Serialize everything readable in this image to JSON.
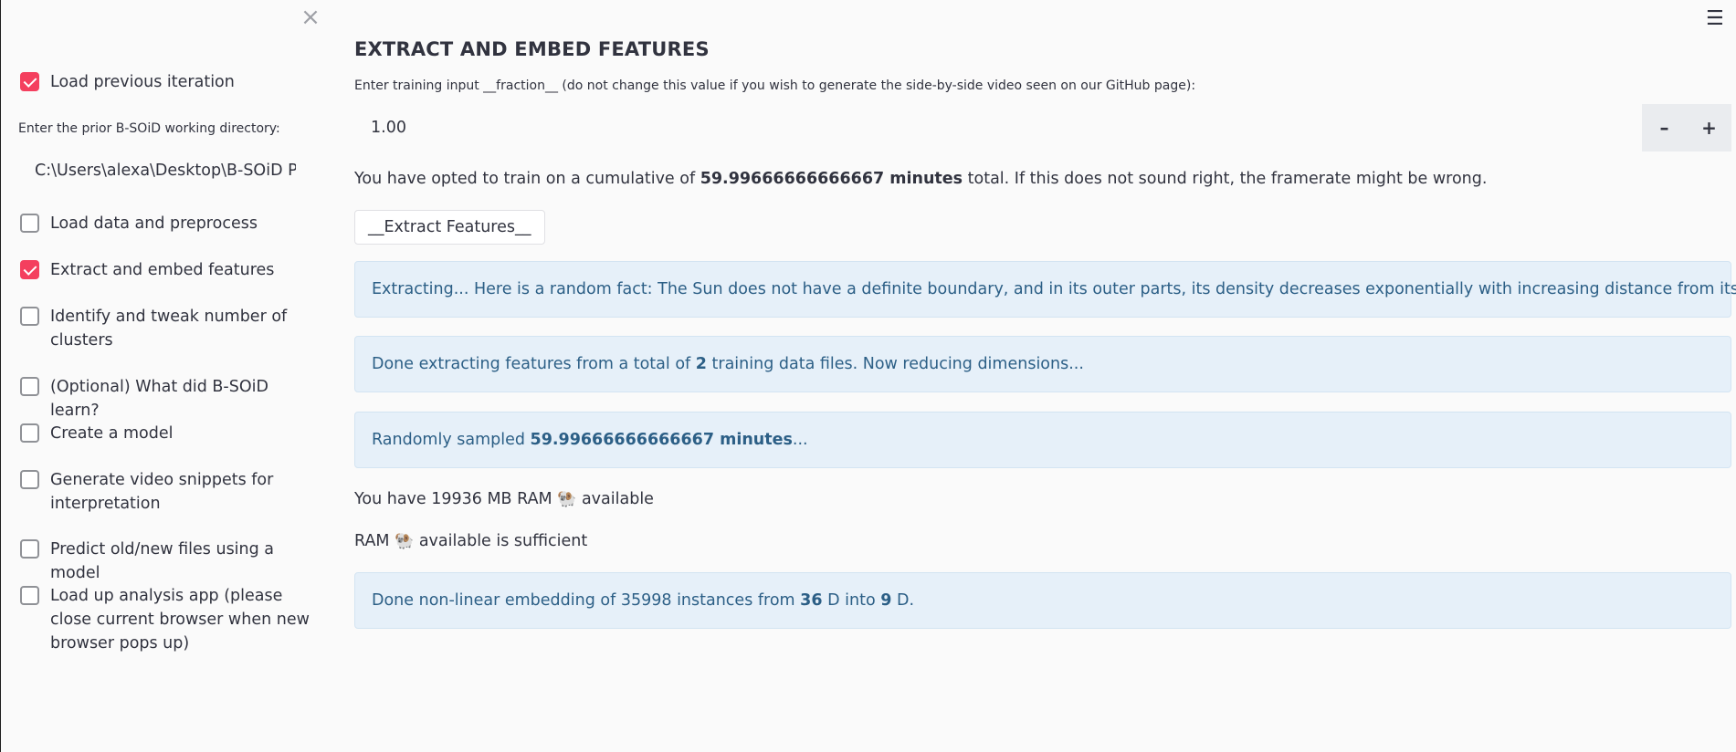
{
  "sidebar": {
    "close_icon": "close-icon",
    "items": [
      {
        "label": "Load previous iteration",
        "checked": true
      },
      {
        "label": "Load data and preprocess",
        "checked": false
      },
      {
        "label": "Extract and embed features",
        "checked": true
      },
      {
        "label": "Identify and tweak number of clusters",
        "checked": false
      },
      {
        "label": "(Optional) What did B-SOiD learn?",
        "checked": false
      },
      {
        "label": "Create a model",
        "checked": false
      },
      {
        "label": "Generate video snippets for interpretation",
        "checked": false
      },
      {
        "label": "Predict old/new files using a model",
        "checked": false
      },
      {
        "label": "Load up analysis app (please close current browser when new browser pops up)",
        "checked": false
      }
    ],
    "dir_label": "Enter the prior B-SOiD working directory:",
    "dir_value": "C:\\Users\\alexa\\Desktop\\B-SOiD Proje"
  },
  "header": {
    "menu_icon": "hamburger-icon"
  },
  "main": {
    "title": "EXTRACT AND EMBED FEATURES",
    "fraction_label": "Enter training input __fraction__ (do not change this value if you wish to generate the side-by-side video seen on our GitHub page):",
    "fraction_value": "1.00",
    "minus_label": "–",
    "plus_label": "+",
    "cumulative_pre": "You have opted to train on a cumulative of ",
    "cumulative_bold": "59.99666666666667 minutes",
    "cumulative_post": " total. If this does not sound right, the framerate might be wrong.",
    "extract_button": "__Extract Features__",
    "alert_extracting": "Extracting... Here is a random fact: The Sun does not have a definite boundary, and in its outer parts, its density decreases exponentially with increasing distance from its center",
    "alert_done_pre": "Done extracting features from a total of ",
    "alert_done_bold": "2",
    "alert_done_post": " training data files. Now reducing dimensions...",
    "alert_sampled_pre": "Randomly sampled ",
    "alert_sampled_bold": "59.99666666666667 minutes",
    "alert_sampled_post": "...",
    "ram_line1_pre": "You have 19936 MB RAM ",
    "ram_line1_post": " available",
    "ram_line2_pre": "RAM ",
    "ram_line2_post": " available is sufficient",
    "ram_emoji": "🐏",
    "embed_pre": "Done non-linear embedding of 35998 instances from ",
    "embed_b1": "36",
    "embed_mid": " D into ",
    "embed_b2": "9",
    "embed_post": " D."
  }
}
